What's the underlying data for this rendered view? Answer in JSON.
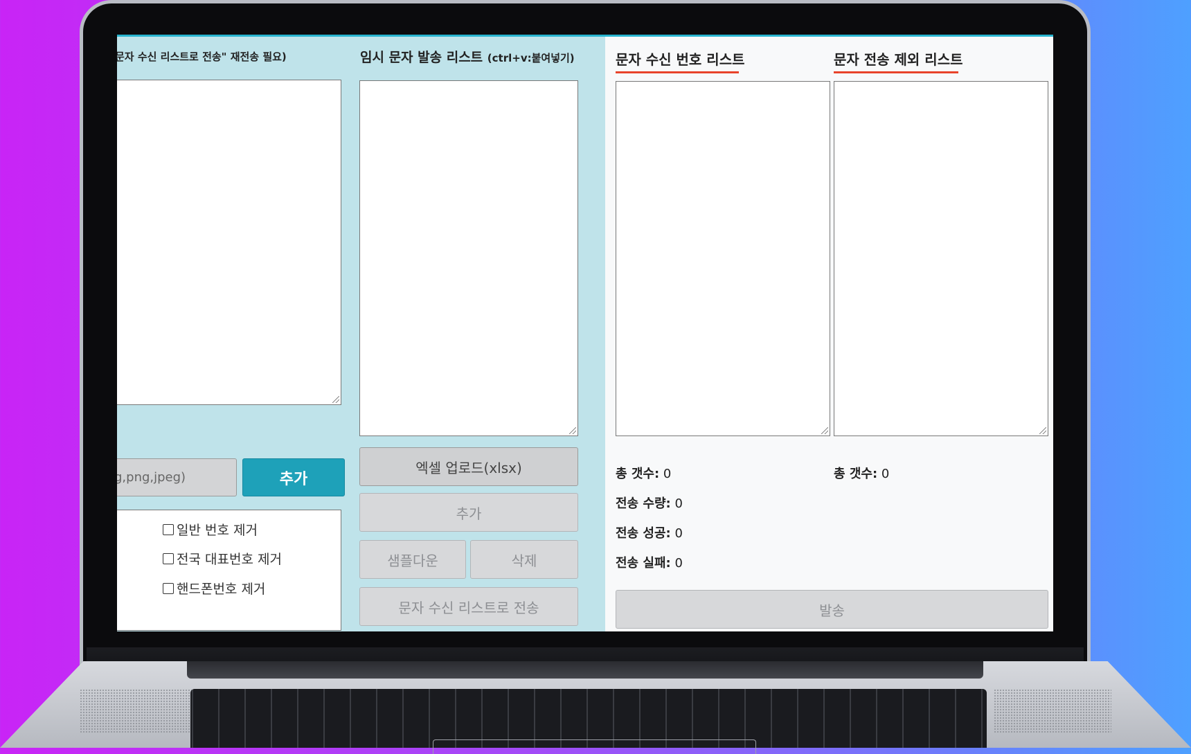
{
  "headers": {
    "left_note": "문자 수신 리스트로 전송\" 재전송 필요)",
    "temp_list": "임시 문자 발송 리스트",
    "temp_list_hint": "(ctrl+v:붙여넣기)",
    "recv_list": "문자 수신 번호 리스트",
    "exclude_list": "문자 전송 제외 리스트"
  },
  "left_column": {
    "file_placeholder": "g,png,jpeg)",
    "add_button": "추가",
    "options": [
      "일반 번호 제거",
      "전국 대표번호 제거",
      "핸드폰번호 제거"
    ]
  },
  "middle_column": {
    "excel_upload": "엑셀 업로드(xlsx)",
    "add": "추가",
    "sample_download": "샘플다운",
    "delete": "삭제",
    "send_to_recv": "문자 수신 리스트로 전송"
  },
  "stats_recv": {
    "total_label": "총 갯수:",
    "total": "0",
    "send_count_label": "전송 수량:",
    "send_count": "0",
    "success_label": "전송 성공:",
    "success": "0",
    "fail_label": "전송 실패:",
    "fail": "0"
  },
  "stats_exclude": {
    "total_label": "총 갯수:",
    "total": "0"
  },
  "send_button": "발송",
  "colors": {
    "accent": "#1ea1b9",
    "underline": "#e8432b",
    "panel_bg": "#bfe3ea"
  }
}
